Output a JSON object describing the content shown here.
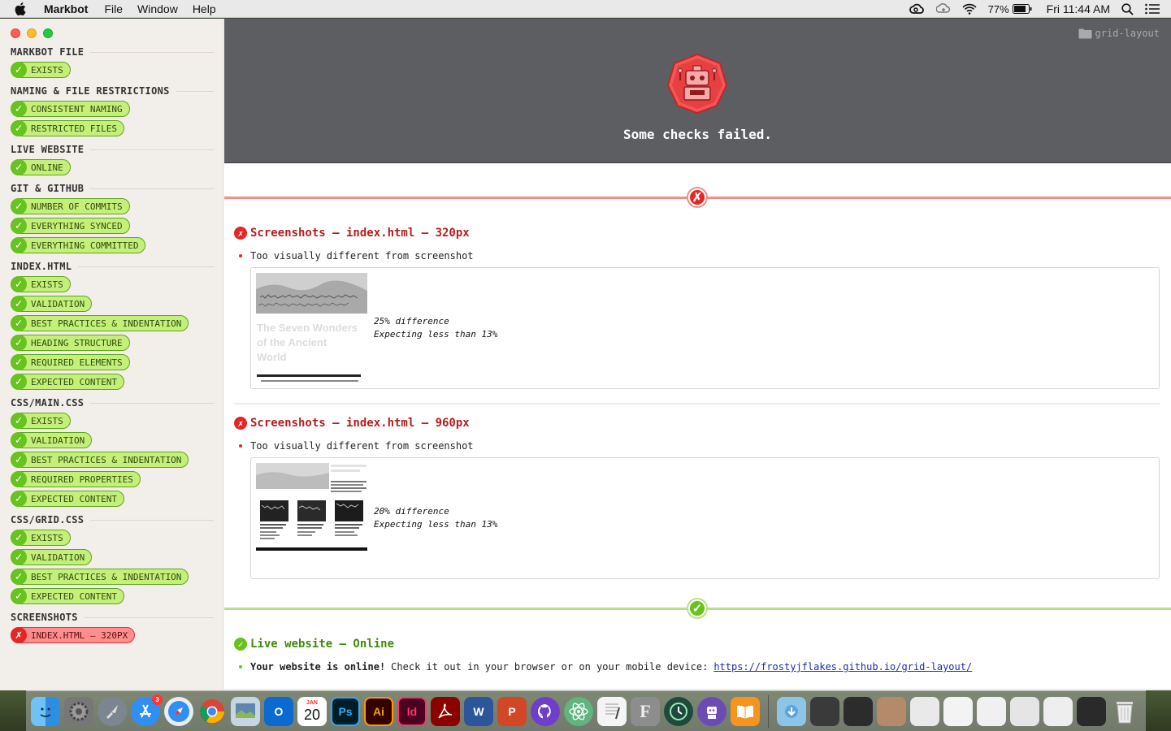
{
  "menubar": {
    "app_name": "Markbot",
    "menus": [
      "File",
      "Window",
      "Help"
    ],
    "battery": "77%",
    "clock": "Fri 11:44 AM"
  },
  "sidebar": {
    "groups": [
      {
        "title": "MARKBOT FILE",
        "checks": [
          {
            "label": "EXISTS",
            "status": "pass"
          }
        ]
      },
      {
        "title": "NAMING & FILE RESTRICTIONS",
        "checks": [
          {
            "label": "CONSISTENT NAMING",
            "status": "pass"
          },
          {
            "label": "RESTRICTED FILES",
            "status": "pass"
          }
        ]
      },
      {
        "title": "LIVE WEBSITE",
        "checks": [
          {
            "label": "ONLINE",
            "status": "pass"
          }
        ]
      },
      {
        "title": "GIT & GITHUB",
        "checks": [
          {
            "label": "NUMBER OF COMMITS",
            "status": "pass"
          },
          {
            "label": "EVERYTHING SYNCED",
            "status": "pass"
          },
          {
            "label": "EVERYTHING COMMITTED",
            "status": "pass"
          }
        ]
      },
      {
        "title": "INDEX.HTML",
        "checks": [
          {
            "label": "EXISTS",
            "status": "pass"
          },
          {
            "label": "VALIDATION",
            "status": "pass"
          },
          {
            "label": "BEST PRACTICES & INDENTATION",
            "status": "pass"
          },
          {
            "label": "HEADING STRUCTURE",
            "status": "pass"
          },
          {
            "label": "REQUIRED ELEMENTS",
            "status": "pass"
          },
          {
            "label": "EXPECTED CONTENT",
            "status": "pass"
          }
        ]
      },
      {
        "title": "CSS/MAIN.CSS",
        "checks": [
          {
            "label": "EXISTS",
            "status": "pass"
          },
          {
            "label": "VALIDATION",
            "status": "pass"
          },
          {
            "label": "BEST PRACTICES & INDENTATION",
            "status": "pass"
          },
          {
            "label": "REQUIRED PROPERTIES",
            "status": "pass"
          },
          {
            "label": "EXPECTED CONTENT",
            "status": "pass"
          }
        ]
      },
      {
        "title": "CSS/GRID.CSS",
        "checks": [
          {
            "label": "EXISTS",
            "status": "pass"
          },
          {
            "label": "VALIDATION",
            "status": "pass"
          },
          {
            "label": "BEST PRACTICES & INDENTATION",
            "status": "pass"
          },
          {
            "label": "EXPECTED CONTENT",
            "status": "pass"
          }
        ]
      },
      {
        "title": "SCREENSHOTS",
        "checks": [
          {
            "label": "INDEX.HTML — 320PX",
            "status": "fail"
          }
        ]
      }
    ]
  },
  "main": {
    "folder": "grid-layout",
    "status_message": "Some checks failed.",
    "failed_sections": [
      {
        "title": "Screenshots — index.html — 320px",
        "message": "Too visually different from screenshot",
        "thumb_title": "The Seven Wonders of the Ancient World",
        "difference": "25% difference",
        "expecting": "Expecting less than 13%"
      },
      {
        "title": "Screenshots — index.html — 960px",
        "message": "Too visually different from screenshot",
        "difference": "20% difference",
        "expecting": "Expecting less than 13%"
      }
    ],
    "passed_sections": [
      {
        "title": "Live website — Online",
        "bold": "Your website is online!",
        "message": "Check it out in your browser or on your mobile device:",
        "link": "https://frostyjflakes.github.io/grid-layout/"
      }
    ]
  },
  "dock": {
    "app_store_badge": "3",
    "calendar_month": "JAN",
    "calendar_day": "20",
    "apps": [
      "Finder",
      "System Preferences",
      "Launchpad",
      "App Store",
      "Safari",
      "Chrome",
      "Preview",
      "Outlook",
      "Calendar",
      "Photoshop",
      "Illustrator",
      "InDesign",
      "Acrobat",
      "Word",
      "PowerPoint",
      "GitHub Desktop",
      "Atom",
      "TextEdit",
      "Font Book",
      "Time Machine",
      "Markbot",
      "iBooks"
    ],
    "app_labels": {
      "ps": "Ps",
      "ai": "Ai",
      "id": "Id",
      "word": "W",
      "ppt": "P"
    }
  }
}
